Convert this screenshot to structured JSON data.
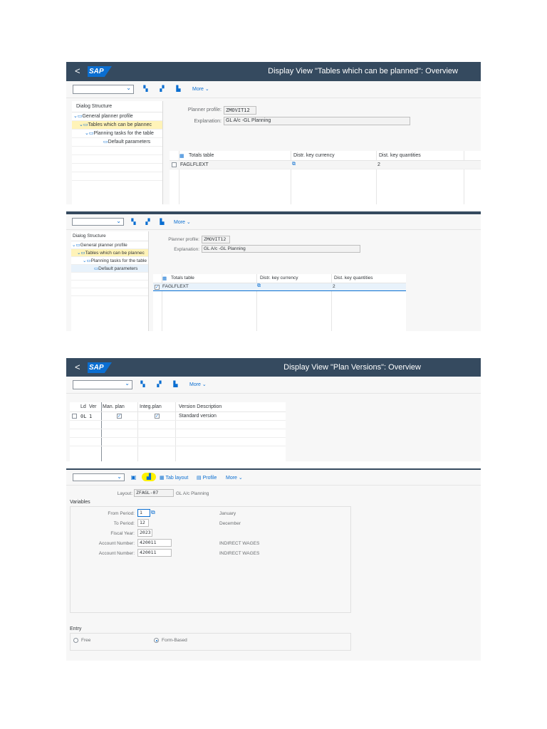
{
  "panel1": {
    "back": "<",
    "logo": "SAP",
    "title": "Display View \"Tables which can be planned\": Overview",
    "more": "More",
    "dialog_header": "Dialog Structure",
    "tree": [
      "General planner profile",
      "Tables which can be plannec",
      "Planning tasks for the table",
      "Default parameters"
    ],
    "planner_profile_label": "Planner profile:",
    "planner_profile_value": "ZMOVIT12",
    "explanation_label": "Explanation:",
    "explanation_value": "GL A/c -GL Planning",
    "col_totals": "Totals table",
    "col_currency": "Distr. key currency",
    "col_quantities": "Dist. key quantities",
    "row_table": "FAGLFLEXT",
    "row_qty": "2"
  },
  "panel2": {
    "more": "More",
    "dialog_header": "Dialog Structure",
    "tree": [
      "General planner profile",
      "Tables which can be plannec",
      "Planning tasks for the table",
      "Default parameters"
    ],
    "planner_profile_label": "Planner profile:",
    "planner_profile_value": "ZMOVIT12",
    "explanation_label": "Explanation:",
    "explanation_value": "GL A/c -GL Planning",
    "col_totals": "Totals table",
    "col_currency": "Distr. key currency",
    "col_quantities": "Dist. key quantities",
    "row_table": "FAGLFLEXT",
    "row_qty": "2",
    "row_check": "✓"
  },
  "panel3": {
    "back": "<",
    "logo": "SAP",
    "title": "Display View \"Plan Versions\": Overview",
    "more": "More",
    "col_ld": "Ld",
    "col_ver": "Ver",
    "col_man": "Man. plan",
    "col_integ": "Integ.plan",
    "col_desc": "Version Description",
    "row_ld": "0L",
    "row_ver": "1",
    "row_man": "✓",
    "row_integ": "✓",
    "row_desc": "Standard version"
  },
  "panel4": {
    "tab_layout": "Tab layout",
    "profile": "Profile",
    "more": "More",
    "layout_label": "Layout:",
    "layout_value": "ZFAGL-07",
    "layout_desc": "GL A/c Planning",
    "variables": "Variables",
    "fields": [
      {
        "label": "From Period:",
        "value": "1",
        "desc": "January"
      },
      {
        "label": "To Period:",
        "value": "12",
        "desc": "December"
      },
      {
        "label": "Fiscal Year:",
        "value": "2023",
        "desc": ""
      },
      {
        "label": "Account Number:",
        "value": "420011",
        "desc": "INDIRECT WAGES"
      },
      {
        "label": "Account Number:",
        "value": "420011",
        "desc": "INDIRECT WAGES"
      }
    ],
    "entry": "Entry",
    "radio_free": "Free",
    "radio_form": "Form-Based"
  },
  "colors": {
    "shell": "#354a5f",
    "accent": "#0a6ed1",
    "highlight": "#fff3b8"
  },
  "icons": [
    "chevron-down-icon",
    "expand-all-icon",
    "collapse-all-icon",
    "hierarchy-icon",
    "folder-icon",
    "table-icon",
    "value-help-icon",
    "settings-icon"
  ]
}
